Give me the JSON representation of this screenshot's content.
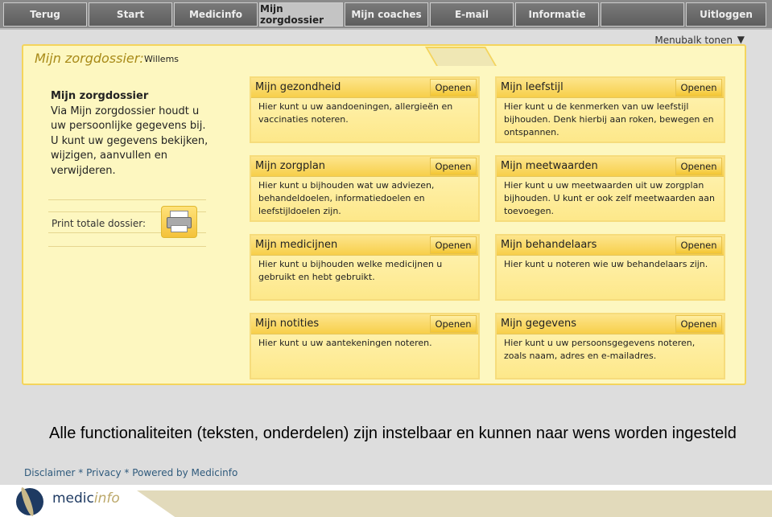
{
  "nav": [
    "Terug",
    "Start",
    "Medicinfo",
    "Mijn zorgdossier",
    "Mijn coaches",
    "E-mail",
    "Informatie",
    "",
    "Uitloggen"
  ],
  "menubalk": "Menubalk tonen",
  "panel": {
    "title": "Mijn zorgdossier:",
    "name": "Willems",
    "intro_title": "Mijn zorgdossier",
    "intro_text": "Via Mijn zorgdossier houdt u uw persoonlijke gegevens bij. U kunt uw gegevens bekijken, wijzigen, aanvullen en verwijderen.",
    "print_label": "Print totale dossier:"
  },
  "open_label": "Openen",
  "boxes": [
    {
      "title": "Mijn gezondheid",
      "text": "Hier kunt u uw aandoeningen, allergieën en vaccinaties noteren."
    },
    {
      "title": "Mijn leefstijl",
      "text": "Hier kunt u de kenmerken van uw leefstijl bijhouden. Denk hierbij aan roken, bewegen en ontspannen."
    },
    {
      "title": "Mijn zorgplan",
      "text": "Hier kunt u bijhouden wat uw adviezen, behandeldoelen, informatiedoelen en leefstijldoelen zijn."
    },
    {
      "title": "Mijn meetwaarden",
      "text": "Hier kunt u uw meetwaarden uit uw zorgplan bijhouden. U kunt er ook zelf meetwaarden aan toevoegen."
    },
    {
      "title": "Mijn medicijnen",
      "text": "Hier kunt u bijhouden welke medicijnen u gebruikt en hebt gebruikt."
    },
    {
      "title": "Mijn behandelaars",
      "text": "Hier kunt u noteren wie uw behandelaars zijn."
    },
    {
      "title": "Mijn notities",
      "text": "Hier kunt u uw aantekeningen noteren."
    },
    {
      "title": "Mijn gegevens",
      "text": "Hier kunt u uw persoonsgegevens noteren, zoals naam, adres en e-mailadres."
    }
  ],
  "caption": "Alle functionaliteiten (teksten, onderdelen) zijn instelbaar en kunnen naar wens worden ingesteld",
  "footer": {
    "links": [
      "Disclaimer",
      "Privacy",
      "Powered by Medicinfo"
    ],
    "sep": " * ",
    "logo_a": "medic",
    "logo_b": "info"
  }
}
